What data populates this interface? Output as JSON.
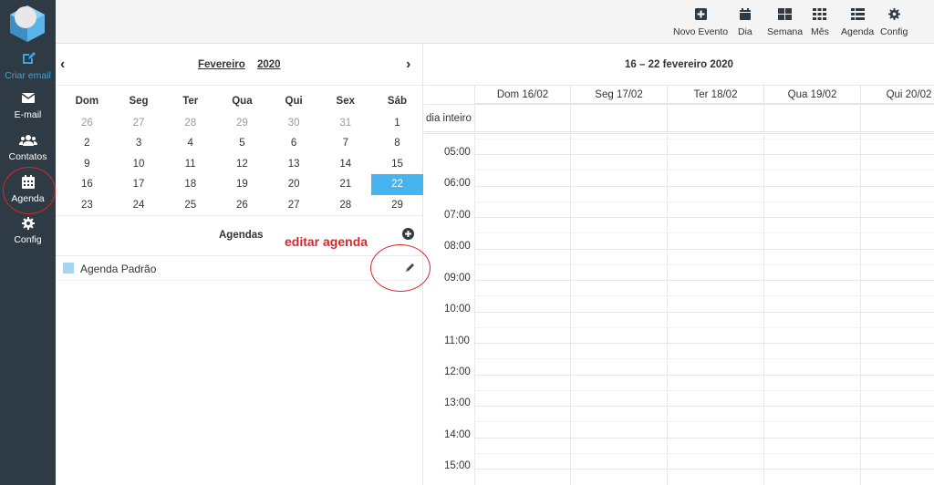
{
  "nav": {
    "items": [
      {
        "label": "Criar email",
        "icon": "compose-icon"
      },
      {
        "label": "E-mail",
        "icon": "envelope-icon"
      },
      {
        "label": "Contatos",
        "icon": "users-icon"
      },
      {
        "label": "Agenda",
        "icon": "calendar-icon"
      },
      {
        "label": "Config",
        "icon": "gear-icon"
      }
    ]
  },
  "toolbar": {
    "novo_evento": "Novo Evento",
    "dia": "Dia",
    "semana": "Semana",
    "mes": "Mês",
    "agenda": "Agenda",
    "config": "Config"
  },
  "minical": {
    "month": "Fevereiro",
    "year": "2020",
    "prev": "‹",
    "next": "›",
    "weekdays": [
      "Dom",
      "Seg",
      "Ter",
      "Qua",
      "Qui",
      "Sex",
      "Sáb"
    ],
    "weeks": [
      [
        "26",
        "27",
        "28",
        "29",
        "30",
        "31",
        "1"
      ],
      [
        "2",
        "3",
        "4",
        "5",
        "6",
        "7",
        "8"
      ],
      [
        "9",
        "10",
        "11",
        "12",
        "13",
        "14",
        "15"
      ],
      [
        "16",
        "17",
        "18",
        "19",
        "20",
        "21",
        "22"
      ],
      [
        "23",
        "24",
        "25",
        "26",
        "27",
        "28",
        "29"
      ]
    ],
    "today": "22"
  },
  "agendas": {
    "title": "Agendas",
    "items": [
      {
        "name": "Agenda Padrão",
        "color": "#a6d4f2"
      }
    ]
  },
  "annotation": {
    "text": "editar agenda",
    "color": "#d9262b"
  },
  "week": {
    "title": "16 – 22 fevereiro 2020",
    "allday_label": "dia inteiro",
    "days": [
      "Dom 16/02",
      "Seg 17/02",
      "Ter 18/02",
      "Qua 19/02",
      "Qui 20/02"
    ],
    "times": [
      "05:00",
      "06:00",
      "07:00",
      "08:00",
      "09:00",
      "10:00",
      "11:00",
      "12:00",
      "13:00",
      "14:00",
      "15:00"
    ]
  },
  "colors": {
    "sidebar": "#2f3b44",
    "accent": "#47b4f0",
    "active_nav": "#3aa5e0"
  }
}
